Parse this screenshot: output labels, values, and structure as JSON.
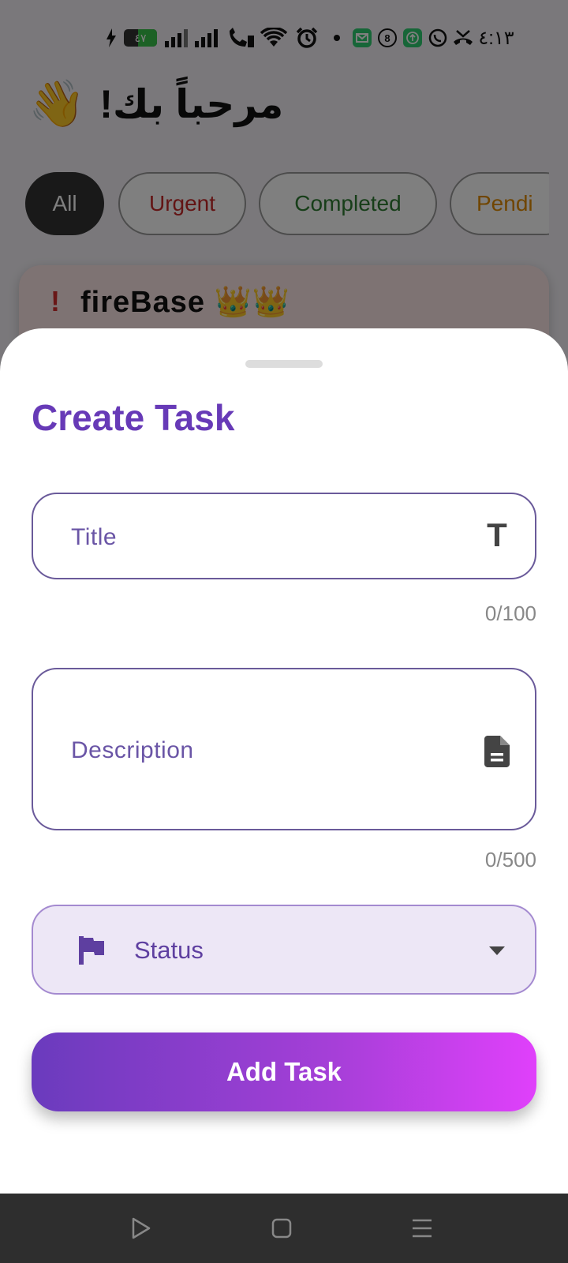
{
  "status_bar": {
    "time": "٤:١٣",
    "battery_level": "٤٧"
  },
  "background": {
    "greeting": "مرحباً بك!",
    "greeting_emoji": "👋",
    "filters": [
      {
        "label": "All",
        "selected": true,
        "color": "#ffffff"
      },
      {
        "label": "Urgent",
        "selected": false,
        "color": "#c62828"
      },
      {
        "label": "Completed",
        "selected": false,
        "color": "#2e7d32"
      },
      {
        "label": "Pendi",
        "selected": false,
        "color": "#e08a00"
      }
    ],
    "task": {
      "priority_mark": "!",
      "title": "fireBase 👑👑"
    }
  },
  "sheet": {
    "title": "Create Task",
    "title_field": {
      "label": "Title",
      "icon": "T",
      "counter": "0/100"
    },
    "description_field": {
      "label": "Description",
      "counter": "0/500"
    },
    "status_field": {
      "label": "Status"
    },
    "add_button": "Add Task"
  },
  "colors": {
    "primary": "#673ab7",
    "gradient_start": "#673ab7",
    "gradient_end": "#e040fb"
  }
}
